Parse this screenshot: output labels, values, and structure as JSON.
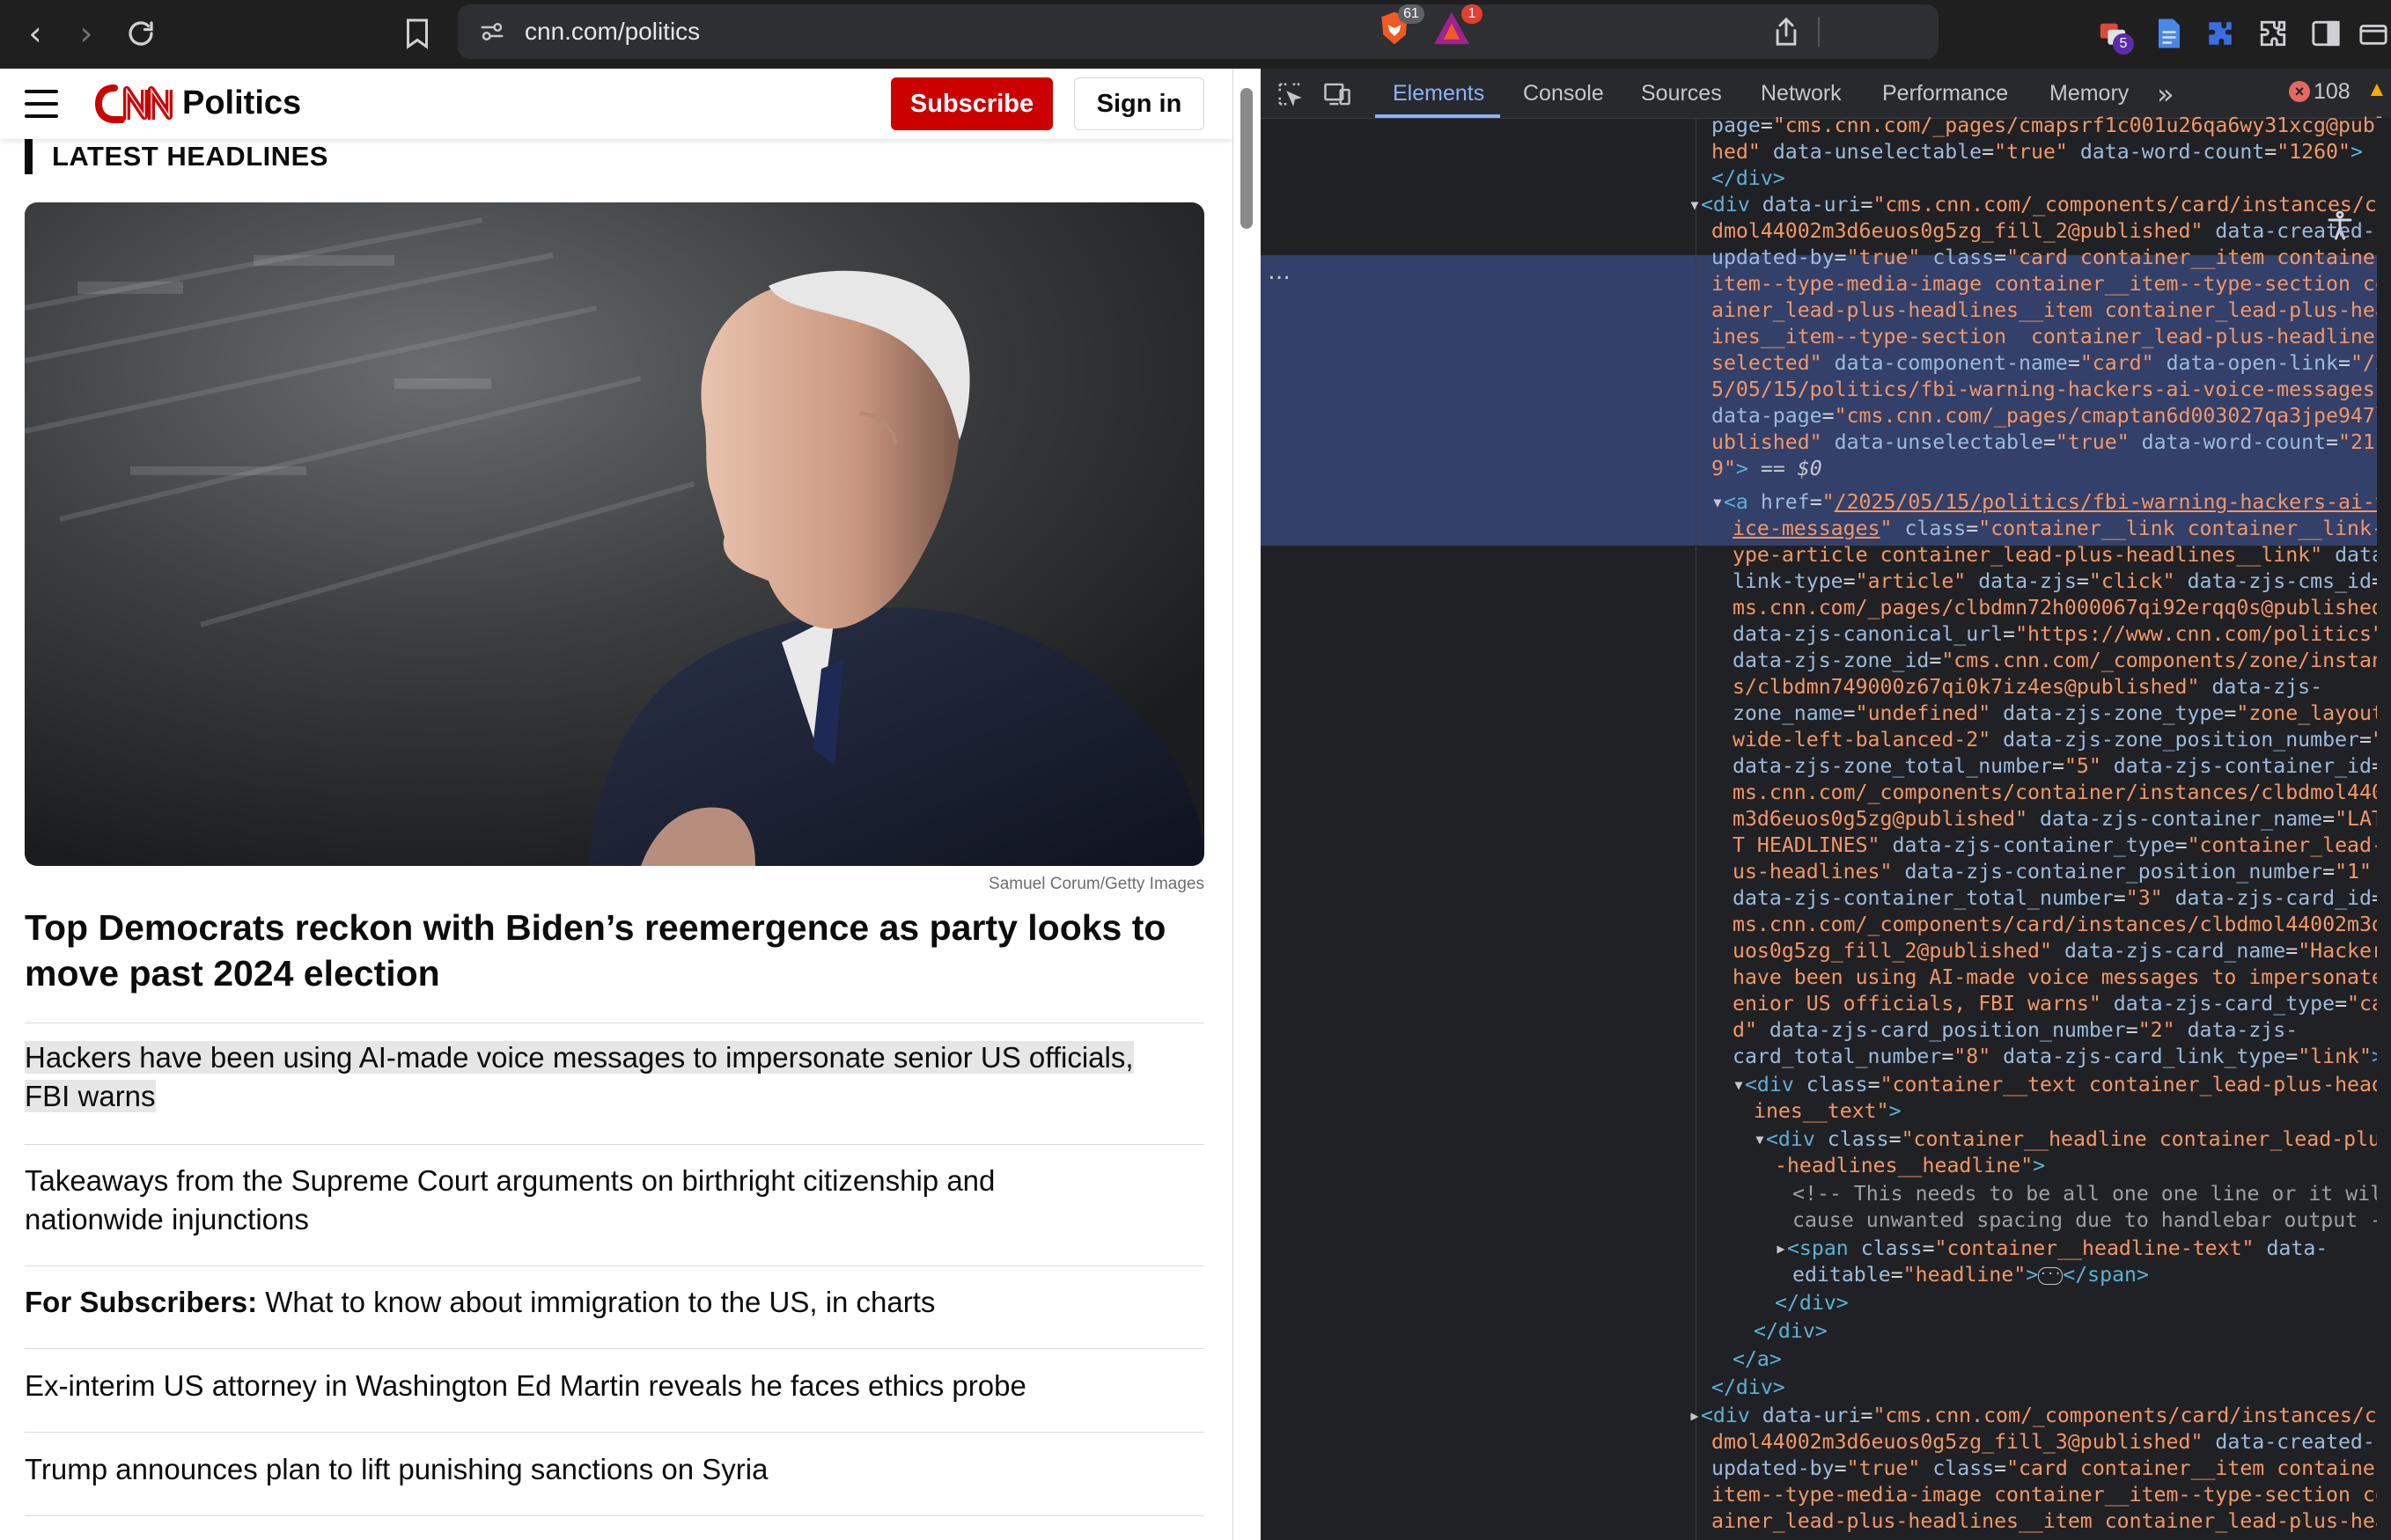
{
  "browser": {
    "url": "cnn.com/politics",
    "brave_shields_count": "61",
    "rewards_count": "1",
    "extension_badge": "5"
  },
  "site": {
    "section": "Politics",
    "subscribe_label": "Subscribe",
    "signin_label": "Sign in",
    "container_title": "LATEST HEADLINES",
    "photo_credit": "Samuel Corum/Getty Images",
    "lead_headline": "Top Democrats reckon with Biden’s reemergence as party looks to move past 2024 election",
    "headlines": [
      {
        "prefix": "",
        "text": "Hackers have been using AI-made voice messages to impersonate senior US officials, FBI warns"
      },
      {
        "prefix": "",
        "text": "Takeaways from the Supreme Court arguments on birthright citizenship and nationwide injunctions"
      },
      {
        "prefix": "For Subscribers:",
        "text": "What to know about immigration to the US, in charts"
      },
      {
        "prefix": "",
        "text": "Ex-interim US attorney in Washington Ed Martin reveals he faces ethics probe"
      },
      {
        "prefix": "",
        "text": "Trump announces plan to lift punishing sanctions on Syria"
      }
    ]
  },
  "devtools": {
    "tabs": [
      "Elements",
      "Console",
      "Sources",
      "Network",
      "Performance",
      "Memory"
    ],
    "active_tab": "Elements",
    "error_count": "108",
    "selected_suffix": "== $0"
  }
}
